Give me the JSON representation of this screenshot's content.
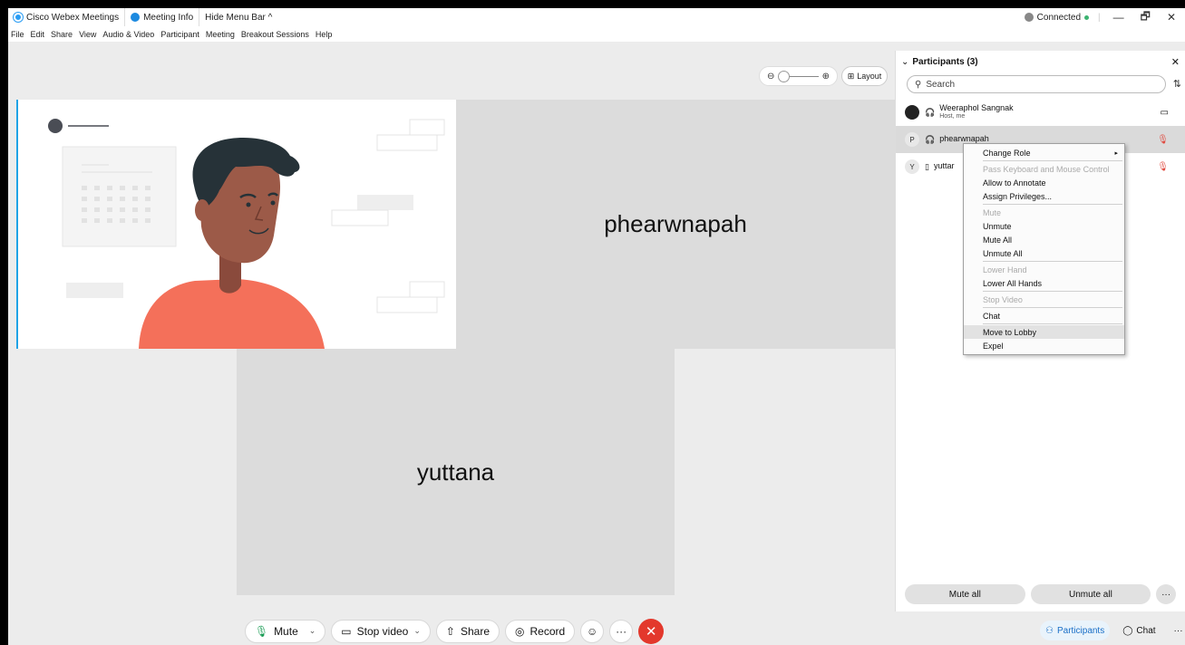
{
  "titlebar": {
    "app_name": "Cisco Webex Meetings",
    "meeting_info": "Meeting Info",
    "hide_menu": "Hide Menu Bar ^",
    "status": "Connected",
    "status_color": "#3cb371"
  },
  "menu": [
    "File",
    "Edit",
    "Share",
    "View",
    "Audio & Video",
    "Participant",
    "Meeting",
    "Breakout Sessions",
    "Help"
  ],
  "stage": {
    "layout_label": "Layout",
    "tile_p_name": "phearwnapah",
    "tile_y_name": "yuttana"
  },
  "controls": {
    "mute": "Mute",
    "stop_video": "Stop video",
    "share": "Share",
    "record": "Record",
    "more": "···"
  },
  "panel": {
    "title": "Participants (3)",
    "search_placeholder": "Search",
    "participants": [
      {
        "initial": "",
        "name": "Weeraphol Sangnak",
        "subtitle": "Host, me"
      },
      {
        "initial": "P",
        "name": "phearwnapah",
        "subtitle": ""
      },
      {
        "initial": "Y",
        "name": "yuttar",
        "subtitle": ""
      }
    ],
    "mute_all": "Mute all",
    "unmute_all": "Unmute all"
  },
  "bottom_right": {
    "participants": "Participants",
    "chat": "Chat",
    "more": "···"
  },
  "context_menu": [
    {
      "label": "Change Role",
      "disabled": false,
      "submenu": true
    },
    {
      "label": "Pass Keyboard and Mouse Control",
      "disabled": true
    },
    {
      "label": "Allow to Annotate",
      "disabled": false
    },
    {
      "label": "Assign Privileges...",
      "disabled": false
    },
    {
      "label": "Mute",
      "disabled": true
    },
    {
      "label": "Unmute",
      "disabled": false
    },
    {
      "label": "Mute All",
      "disabled": false
    },
    {
      "label": "Unmute All",
      "disabled": false
    },
    {
      "label": "Lower Hand",
      "disabled": true
    },
    {
      "label": "Lower All Hands",
      "disabled": false
    },
    {
      "label": "Stop Video",
      "disabled": true
    },
    {
      "label": "Chat",
      "disabled": false
    },
    {
      "label": "Move to Lobby",
      "disabled": false,
      "highlighted": true
    },
    {
      "label": "Expel",
      "disabled": false
    }
  ],
  "colors": {
    "accent": "#1a6fc7",
    "end_call": "#e3382c",
    "avatar_shirt": "#f4705a"
  }
}
